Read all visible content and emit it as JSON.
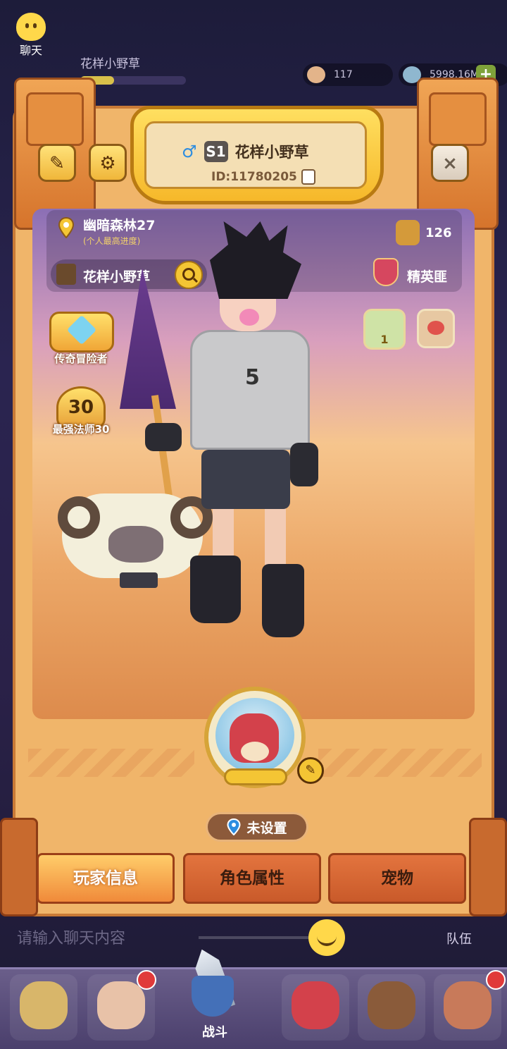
{
  "hud": {
    "chat_label": "聊天",
    "player_name": "花样小野草",
    "resource1_value": "117",
    "resource2_value": "5998.16M",
    "plus_label": "+"
  },
  "header": {
    "gender_icon": "♂",
    "server_badge": "S1",
    "player_name": "花样小野草",
    "player_id": "ID:11780205"
  },
  "info": {
    "location_name": "幽暗森林27",
    "location_note": "(个人最高进度)",
    "player_name": "花样小野草",
    "likes_count": "126",
    "guild_name": "精英匪"
  },
  "titles": {
    "title1": "传奇冒险者",
    "title2": "最强法师30",
    "title2_level": "30"
  },
  "character": {
    "shirt_number": "5"
  },
  "location_button": {
    "label": "未设置"
  },
  "tabs": [
    {
      "label": "玩家信息",
      "active": true
    },
    {
      "label": "角色属性",
      "active": false
    },
    {
      "label": "宠物",
      "active": false
    }
  ],
  "chat": {
    "placeholder": "请输入聊天内容",
    "team_label": "队伍"
  },
  "bottom_nav": {
    "battle_label": "战斗"
  },
  "icons": {
    "close": "×",
    "settings": "⚙",
    "edit": "✎",
    "pencil": "✎"
  },
  "colors": {
    "panel": "#f0b56a",
    "tab_active": "#ffcd6a",
    "tab_inactive": "#e3743e",
    "accent_gold": "#f4c534"
  }
}
